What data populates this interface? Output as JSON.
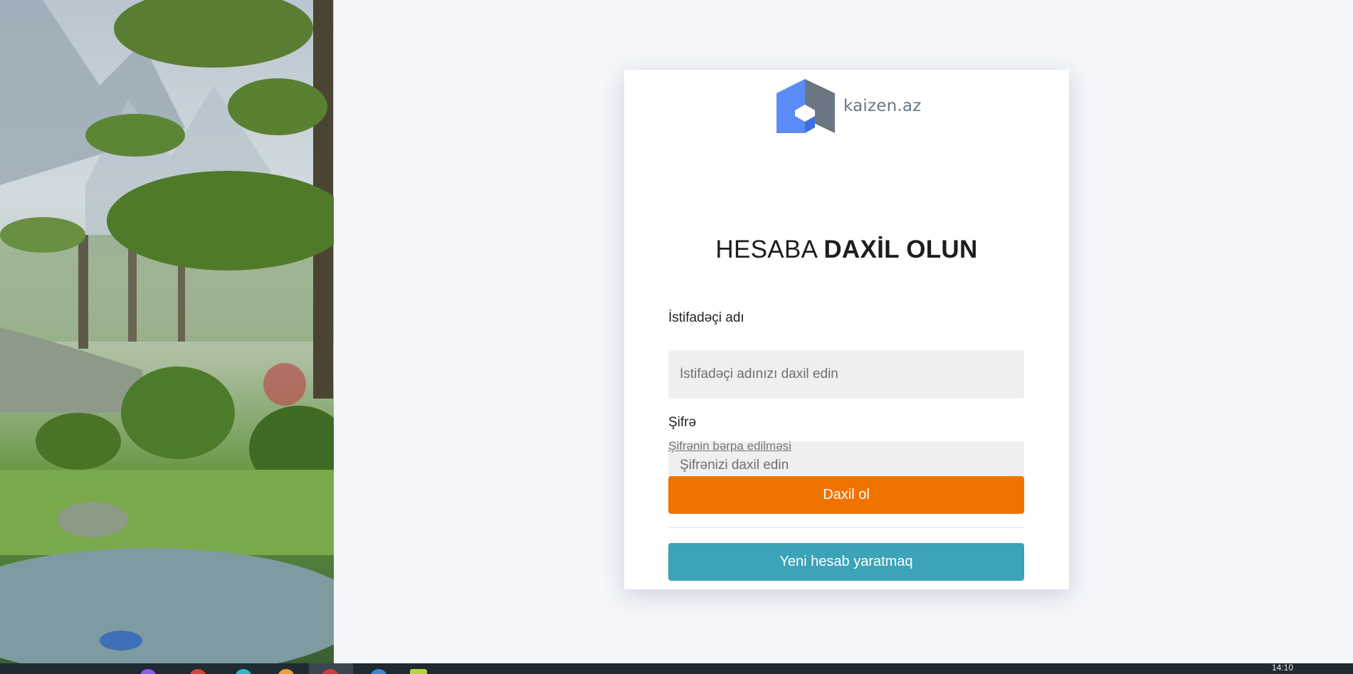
{
  "brand": {
    "name": "kaizen.az",
    "logo_colors": {
      "blue": "#5b8cf5",
      "gray": "#6b7683"
    }
  },
  "login": {
    "title_light": "HESABA",
    "title_bold": "DAXİL OLUN",
    "username_label": "İstifadəçi adı",
    "username_placeholder": "İstifadəçi adınızı daxil edin",
    "username_value": "",
    "password_label": "Şifrə",
    "password_placeholder": "Şifrənizi daxil edin",
    "password_value": "",
    "forgot_link": "Şifrənin bərpa edilməsi",
    "login_button": "Daxil ol",
    "register_button": "Yeni hesab yaratmaq"
  },
  "colors": {
    "page_background": "#f4f6fb",
    "login_button": "#f07300",
    "register_button": "#3ca3b8",
    "input_background": "#efefef"
  },
  "taskbar": {
    "clock": "14:10",
    "icons": [
      "app-purple-icon",
      "app-red-icon",
      "app-teal-icon",
      "app-orange-icon",
      "app-active-icon",
      "app-blue-icon",
      "app-yellow-icon"
    ]
  }
}
